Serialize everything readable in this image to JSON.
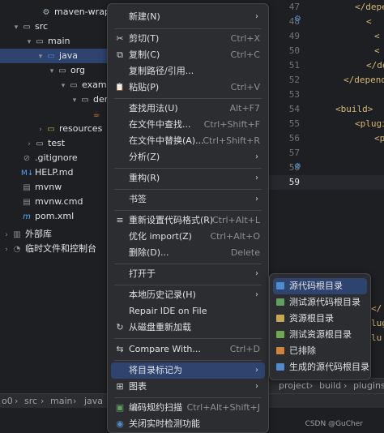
{
  "tree": {
    "rows": [
      {
        "label": "maven-wrapp",
        "icon": "gear-icon",
        "glyph": "⚙"
      },
      {
        "label": "src",
        "icon": "folder-icon",
        "glyph": "▭"
      },
      {
        "label": "main",
        "icon": "folder-icon",
        "glyph": "▭"
      },
      {
        "label": "java",
        "icon": "source-folder-icon",
        "glyph": "▭"
      },
      {
        "label": "org",
        "icon": "package-icon",
        "glyph": "▭"
      },
      {
        "label": "examp",
        "icon": "package-icon",
        "glyph": "▭"
      },
      {
        "label": "der",
        "icon": "package-icon",
        "glyph": "▭"
      },
      {
        "label": "",
        "icon": "java-file-icon",
        "glyph": "☕"
      },
      {
        "label": "resources",
        "icon": "resources-folder-icon",
        "glyph": "▭"
      },
      {
        "label": "test",
        "icon": "folder-icon",
        "glyph": "▭"
      },
      {
        "label": ".gitignore",
        "icon": "gitignore-icon",
        "glyph": "⊘"
      },
      {
        "label": "HELP.md",
        "icon": "markdown-icon",
        "glyph": "M↓"
      },
      {
        "label": "mvnw",
        "icon": "file-icon",
        "glyph": "▤"
      },
      {
        "label": "mvnw.cmd",
        "icon": "file-icon",
        "glyph": "▤"
      },
      {
        "label": "pom.xml",
        "icon": "maven-icon",
        "glyph": "m"
      },
      {
        "label": "外部库",
        "icon": "library-icon",
        "glyph": "▥"
      },
      {
        "label": "临时文件和控制台",
        "icon": "console-icon",
        "glyph": "◔"
      }
    ]
  },
  "editor": {
    "line_numbers": [
      "47",
      "48",
      "49",
      "50",
      "51",
      "52",
      "53",
      "54",
      "55",
      "56",
      "57",
      "58",
      "59"
    ],
    "code": [
      "</depe",
      "<",
      "<",
      "<",
      "</depe",
      "</depender",
      "",
      "<build>",
      "<plugi",
      "<p",
      "",
      "",
      ""
    ],
    "tail": [
      "</",
      "lug",
      "lu"
    ]
  },
  "bottom_tabs": {
    "project": "project",
    "sep1": "›",
    "build": "build",
    "sep2": "›",
    "plugins": "plugins"
  },
  "status": {
    "root": "o0",
    "sep1": "›",
    "src": "src",
    "sep2": "›",
    "main": "main",
    "sep3": "›",
    "java": "java"
  },
  "watermark": "CSDN @GuCher",
  "context_menu": {
    "items": [
      {
        "label": "新建(N)",
        "shortcut": "",
        "arrow": true,
        "icon": "",
        "glyph": ""
      },
      {
        "label": "剪切(T)",
        "shortcut": "Ctrl+X",
        "arrow": false,
        "icon": "scissors-icon",
        "glyph": "✂"
      },
      {
        "label": "复制(C)",
        "shortcut": "Ctrl+C",
        "arrow": false,
        "icon": "copy-icon",
        "glyph": "⧉"
      },
      {
        "label": "复制路径/引用...",
        "shortcut": "",
        "arrow": false,
        "icon": "",
        "glyph": ""
      },
      {
        "label": "粘贴(P)",
        "shortcut": "Ctrl+V",
        "arrow": false,
        "icon": "paste-icon",
        "glyph": "📋"
      },
      {
        "label": "查找用法(U)",
        "shortcut": "Alt+F7",
        "arrow": false,
        "icon": "",
        "glyph": ""
      },
      {
        "label": "在文件中查找...",
        "shortcut": "Ctrl+Shift+F",
        "arrow": false,
        "icon": "",
        "glyph": ""
      },
      {
        "label": "在文件中替换(A)...",
        "shortcut": "Ctrl+Shift+R",
        "arrow": false,
        "icon": "",
        "glyph": ""
      },
      {
        "label": "分析(Z)",
        "shortcut": "",
        "arrow": true,
        "icon": "",
        "glyph": ""
      },
      {
        "label": "重构(R)",
        "shortcut": "",
        "arrow": true,
        "icon": "",
        "glyph": ""
      },
      {
        "label": "书签",
        "shortcut": "",
        "arrow": true,
        "icon": "",
        "glyph": ""
      },
      {
        "label": "重新设置代码格式(R)",
        "shortcut": "Ctrl+Alt+L",
        "arrow": false,
        "icon": "reformat-icon",
        "glyph": "≡"
      },
      {
        "label": "优化 import(Z)",
        "shortcut": "Ctrl+Alt+O",
        "arrow": false,
        "icon": "",
        "glyph": ""
      },
      {
        "label": "删除(D)...",
        "shortcut": "Delete",
        "arrow": false,
        "icon": "",
        "glyph": ""
      },
      {
        "label": "打开于",
        "shortcut": "",
        "arrow": true,
        "icon": "",
        "glyph": ""
      },
      {
        "label": "本地历史记录(H)",
        "shortcut": "",
        "arrow": true,
        "icon": "",
        "glyph": ""
      },
      {
        "label": "Repair IDE on File",
        "shortcut": "",
        "arrow": false,
        "icon": "",
        "glyph": ""
      },
      {
        "label": "从磁盘重新加载",
        "shortcut": "",
        "arrow": false,
        "icon": "reload-icon",
        "glyph": "↻"
      },
      {
        "label": "Compare With...",
        "shortcut": "Ctrl+D",
        "arrow": false,
        "icon": "compare-icon",
        "glyph": "⇆"
      },
      {
        "label": "将目录标记为",
        "shortcut": "",
        "arrow": true,
        "icon": "",
        "glyph": ""
      },
      {
        "label": "图表",
        "shortcut": "",
        "arrow": true,
        "icon": "diagram-icon",
        "glyph": "⊞"
      },
      {
        "label": "编码规约扫描",
        "shortcut": "Ctrl+Alt+Shift+J",
        "arrow": false,
        "icon": "scan-icon",
        "glyph": "▣"
      },
      {
        "label": "关闭实时检测功能",
        "shortcut": "",
        "arrow": false,
        "icon": "realtime-check-icon",
        "glyph": "◉"
      }
    ]
  },
  "submenu": {
    "items": [
      {
        "label": "源代码根目录",
        "color": "#4e8ccf"
      },
      {
        "label": "测试源代码根目录",
        "color": "#5fa05f"
      },
      {
        "label": "资源根目录",
        "color": "#c6a94f"
      },
      {
        "label": "测试资源根目录",
        "color": "#6fa84e"
      },
      {
        "label": "已排除",
        "color": "#d2833a"
      },
      {
        "label": "生成的源代码根目录",
        "color": "#4e8ccf"
      }
    ]
  }
}
